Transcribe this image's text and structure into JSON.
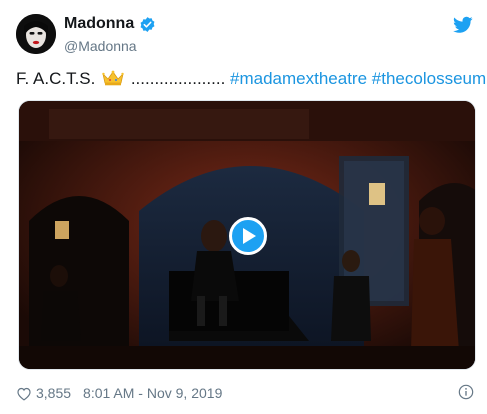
{
  "user": {
    "display_name": "Madonna",
    "handle": "@Madonna",
    "verified": true
  },
  "tweet": {
    "text_prefix": "F. A.C.T.S.",
    "text_dots": "....................",
    "hashtags": [
      "#madamextheatre",
      "#thecolosseum"
    ]
  },
  "footer": {
    "like_count": "3,855",
    "timestamp": "8:01 AM - Nov 9, 2019"
  },
  "icons": {
    "verified": "verified-badge-icon",
    "platform": "twitter-bird-icon",
    "crown": "crown-emoji-icon",
    "play": "play-icon",
    "like": "heart-icon",
    "info": "info-icon"
  },
  "colors": {
    "accent": "#1da1f2",
    "hashtag": "#1b95e0",
    "muted": "#657786",
    "text": "#14171a"
  }
}
